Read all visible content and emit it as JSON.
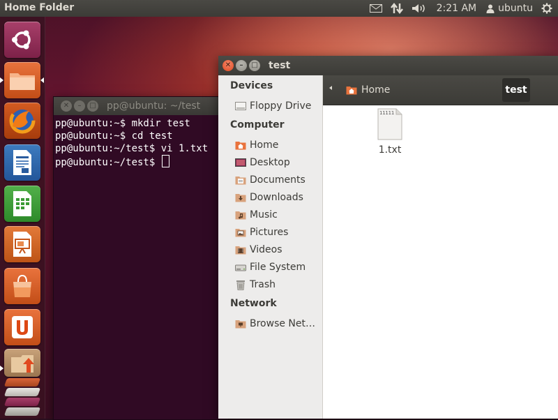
{
  "top_panel": {
    "app_title": "Home Folder",
    "clock": "2:21 AM",
    "user": "ubuntu",
    "indicators": [
      "mail-icon",
      "network-icon",
      "volume-icon",
      "power-cog-icon"
    ]
  },
  "launcher": {
    "items": [
      {
        "name": "dash-home",
        "icon": "ubuntu-logo-icon"
      },
      {
        "name": "home-folder",
        "icon": "folder-icon",
        "active": true
      },
      {
        "name": "firefox",
        "icon": "firefox-icon"
      },
      {
        "name": "libreoffice-writer",
        "icon": "writer-icon"
      },
      {
        "name": "libreoffice-calc",
        "icon": "calc-icon"
      },
      {
        "name": "libreoffice-impress",
        "icon": "impress-icon"
      },
      {
        "name": "software-center",
        "icon": "shopping-bag-icon"
      },
      {
        "name": "ubuntu-one",
        "icon": "ubuntu-one-icon"
      },
      {
        "name": "update-manager",
        "icon": "update-icon"
      }
    ]
  },
  "terminal": {
    "title": "pp@ubuntu: ~/test",
    "lines": [
      "pp@ubuntu:~$ mkdir test",
      "pp@ubuntu:~$ cd test",
      "pp@ubuntu:~/test$ vi 1.txt",
      "pp@ubuntu:~/test$ "
    ]
  },
  "file_manager": {
    "title": "test",
    "breadcrumbs": [
      "Home",
      "test"
    ],
    "sidebar": {
      "devices_heading": "Devices",
      "devices": [
        {
          "label": "Floppy Drive",
          "icon": "floppy-icon"
        }
      ],
      "computer_heading": "Computer",
      "computer": [
        {
          "label": "Home",
          "icon": "home-folder-icon"
        },
        {
          "label": "Desktop",
          "icon": "desktop-icon"
        },
        {
          "label": "Documents",
          "icon": "documents-folder-icon"
        },
        {
          "label": "Downloads",
          "icon": "downloads-folder-icon"
        },
        {
          "label": "Music",
          "icon": "music-folder-icon"
        },
        {
          "label": "Pictures",
          "icon": "pictures-folder-icon"
        },
        {
          "label": "Videos",
          "icon": "videos-folder-icon"
        },
        {
          "label": "File System",
          "icon": "drive-icon"
        },
        {
          "label": "Trash",
          "icon": "trash-icon"
        }
      ],
      "network_heading": "Network",
      "network": [
        {
          "label": "Browse Net…",
          "icon": "network-folder-icon"
        }
      ]
    },
    "files": [
      {
        "name": "1.txt",
        "preview": "11111",
        "icon": "text-file-icon"
      }
    ]
  },
  "colors": {
    "terminal_bg": "#300a24",
    "panel_bg": "#3c3b37",
    "accent_orange": "#e0491f"
  }
}
